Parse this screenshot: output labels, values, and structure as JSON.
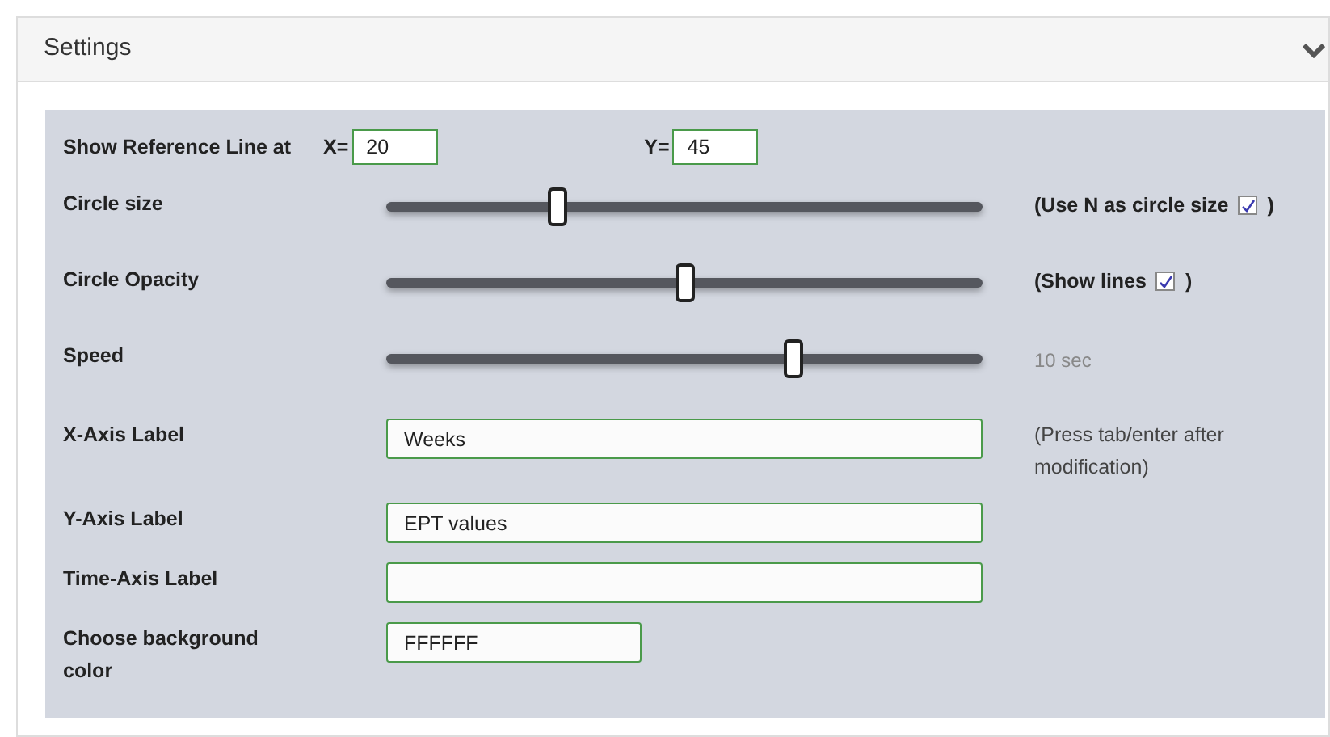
{
  "panel": {
    "title": "Settings",
    "expanded": true
  },
  "reference_line": {
    "label": "Show Reference Line at",
    "x_label": "X=",
    "x_value": "20",
    "y_label": "Y=",
    "y_value": "45"
  },
  "rows": [
    {
      "kind": "slider",
      "label": "Circle size",
      "level": 0.287,
      "note": {
        "before": "(Use N as circle size",
        "after": ")",
        "checked": true
      }
    },
    {
      "kind": "slider",
      "label": "Circle Opacity",
      "level": 0.5,
      "note": {
        "before": "(Show lines",
        "after": ")",
        "checked": true
      }
    },
    {
      "kind": "slider",
      "label": "Speed",
      "level": 0.683,
      "reading": "10 sec"
    },
    {
      "kind": "text",
      "label": "X-Axis Label",
      "value": "Weeks",
      "hint": "(Press tab/enter after modification)"
    },
    {
      "kind": "text",
      "label": "Y-Axis Label",
      "value": "EPT values"
    },
    {
      "kind": "text",
      "label": "Time-Axis Label"
    },
    {
      "kind": "color",
      "label": "Choose background color",
      "value": "FFFFFF"
    }
  ]
}
